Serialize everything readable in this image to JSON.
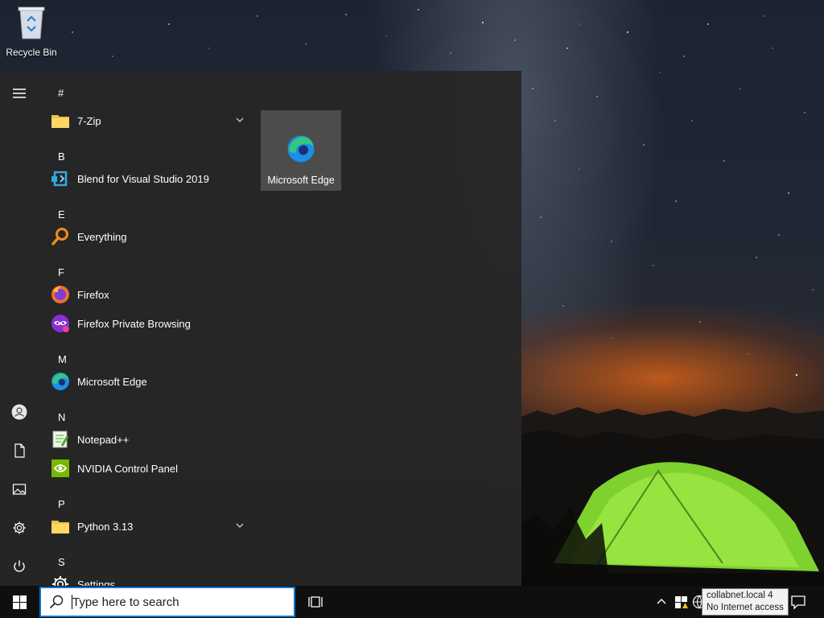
{
  "desktop": {
    "recycle_bin_label": "Recycle Bin"
  },
  "start_menu": {
    "rail": {
      "hamburger": "hamburger-icon",
      "user": "user-icon",
      "documents": "document-icon",
      "pictures": "pictures-icon",
      "settings": "gear-icon",
      "power": "power-icon"
    },
    "sections": [
      {
        "letter": "#",
        "apps": [
          {
            "name": "7-Zip",
            "icon": "folder-icon",
            "expandable": true
          }
        ]
      },
      {
        "letter": "B",
        "apps": [
          {
            "name": "Blend for Visual Studio 2019",
            "icon": "blend-icon"
          }
        ]
      },
      {
        "letter": "E",
        "apps": [
          {
            "name": "Everything",
            "icon": "magnifier-icon"
          }
        ]
      },
      {
        "letter": "F",
        "apps": [
          {
            "name": "Firefox",
            "icon": "firefox-icon"
          },
          {
            "name": "Firefox Private Browsing",
            "icon": "firefox-private-icon"
          }
        ]
      },
      {
        "letter": "M",
        "apps": [
          {
            "name": "Microsoft Edge",
            "icon": "edge-icon"
          }
        ]
      },
      {
        "letter": "N",
        "apps": [
          {
            "name": "Notepad++",
            "icon": "notepadpp-icon"
          },
          {
            "name": "NVIDIA Control Panel",
            "icon": "nvidia-icon"
          }
        ]
      },
      {
        "letter": "P",
        "apps": [
          {
            "name": "Python 3.13",
            "icon": "folder-icon",
            "expandable": true
          }
        ]
      },
      {
        "letter": "S",
        "apps": [
          {
            "name": "Settings",
            "icon": "gear-icon"
          }
        ]
      }
    ],
    "tiles": [
      {
        "label": "Microsoft Edge",
        "icon": "edge-icon"
      }
    ]
  },
  "taskbar": {
    "search_placeholder": "Type here to search",
    "tooltip_line1": "collabnet.local 4",
    "tooltip_line2": "No Internet access"
  },
  "colors": {
    "accent": "#0078d7",
    "menu_bg": "#262626",
    "taskbar_bg": "#101010",
    "tent_green": "#8ee23a",
    "horizon_orange": "#d66218"
  }
}
